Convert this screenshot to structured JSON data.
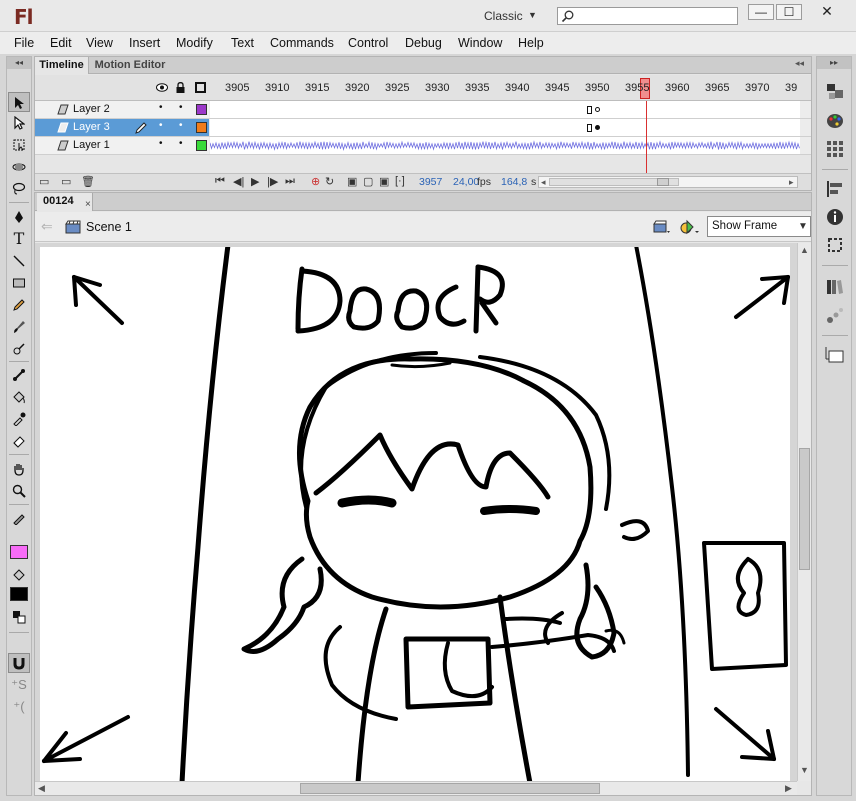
{
  "app": {
    "logo": "Fl",
    "workspace": "Classic",
    "window_buttons": {
      "minimize": "—",
      "maximize": "☐",
      "close": "✕"
    }
  },
  "menu": [
    "File",
    "Edit",
    "View",
    "Insert",
    "Modify",
    "Text",
    "Commands",
    "Control",
    "Debug",
    "Window",
    "Help"
  ],
  "tools": [
    "selection-arrow",
    "subselection",
    "free-transform",
    "3d-rotation",
    "lasso",
    "pen",
    "text",
    "line",
    "rectangle",
    "pencil",
    "brush",
    "deco",
    "bone",
    "paint-bucket",
    "eyedropper",
    "eraser",
    "hand",
    "zoom",
    "stroke-color",
    "fill-color",
    "swap-colors",
    "snap-magnet",
    "smooth",
    "straighten"
  ],
  "colors": {
    "stroke": "#000000",
    "fill": "#f76cf7",
    "accent": "#5b9bd6",
    "playhead": "#d93030"
  },
  "timeline": {
    "tabs": [
      "Timeline",
      "Motion Editor"
    ],
    "frame_numbers": [
      "3905",
      "3910",
      "3915",
      "3920",
      "3925",
      "3930",
      "3935",
      "3940",
      "3945",
      "3950",
      "3955",
      "3960",
      "3965",
      "3970",
      "39"
    ],
    "layers": [
      {
        "name": "Layer 2",
        "color": "#9b38c9",
        "selected": false
      },
      {
        "name": "Layer 3",
        "color": "#f07c1a",
        "selected": true
      },
      {
        "name": "Layer 1",
        "color": "#3adb3a",
        "selected": false
      }
    ],
    "current_frame": "3957",
    "fps": "24,00",
    "fps_unit": "fps",
    "elapsed": "164,8",
    "elapsed_unit": "s"
  },
  "document": {
    "tab": "00124",
    "tab_close": "×",
    "scene": "Scene 1",
    "zoom": "Show Frame",
    "drawing_text": "DOOR",
    "note_glyph": "8"
  },
  "right_panel": [
    "library-panel",
    "color-panel",
    "swatches-panel",
    "align-panel",
    "info-panel",
    "transform-panel",
    "components-panel",
    "motion-presets-panel",
    "project-panel"
  ]
}
